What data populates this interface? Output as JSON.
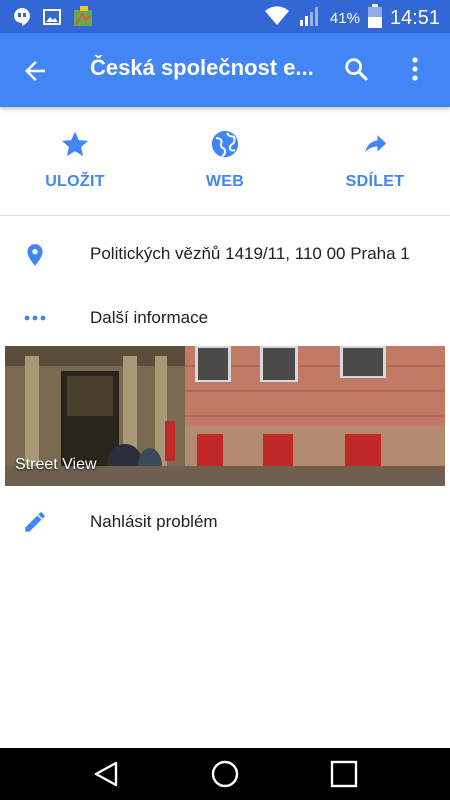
{
  "status_bar": {
    "battery_percent": "41%",
    "time": "14:51",
    "icons": [
      "hangouts-icon",
      "image-icon",
      "app-icon",
      "wifi-icon",
      "signal-icon",
      "battery-icon"
    ]
  },
  "app_bar": {
    "title": "Česká společnost e..."
  },
  "actions": [
    {
      "label": "ULOŽIT",
      "icon": "star-icon"
    },
    {
      "label": "WEB",
      "icon": "globe-icon"
    },
    {
      "label": "SDÍLET",
      "icon": "share-icon"
    }
  ],
  "details": {
    "address": "Politických vězňů 1419/11, 110 00 Praha 1",
    "more_info": "Další informace",
    "street_view_label": "Street View",
    "report_problem": "Nahlásit problém"
  },
  "colors": {
    "status_bar": "#3367d6",
    "app_bar": "#4285f4",
    "accent": "#4285f4"
  }
}
